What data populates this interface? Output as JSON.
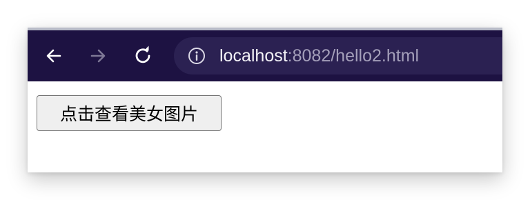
{
  "browser": {
    "toolbar_color": "#1d1242",
    "url": {
      "host": "localhost",
      "path": ":8082/hello2.html"
    },
    "nav": {
      "back_icon": "arrow-left",
      "forward_icon": "arrow-right",
      "reload_icon": "reload"
    },
    "site_info_icon": "info-circle"
  },
  "page": {
    "button_label": "点击查看美女图片"
  }
}
